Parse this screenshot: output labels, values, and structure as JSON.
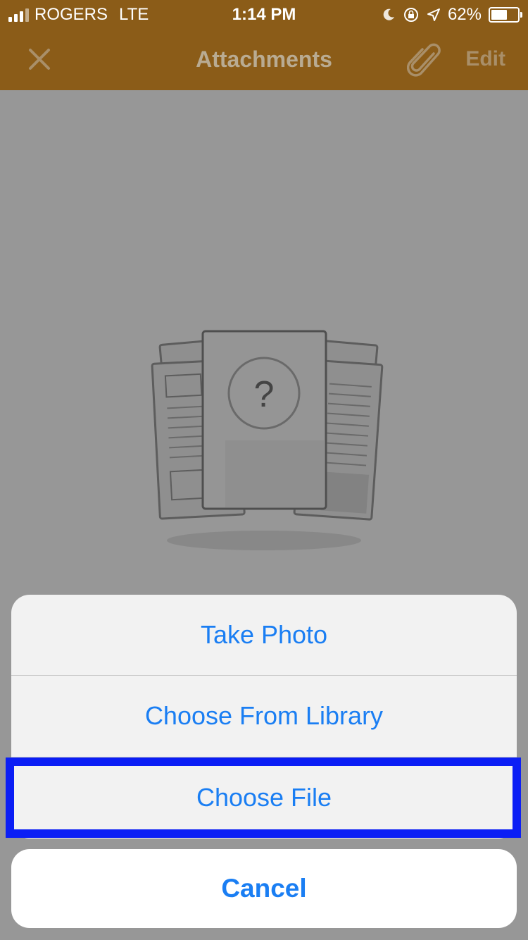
{
  "status_bar": {
    "carrier": "ROGERS",
    "network": "LTE",
    "time": "1:14 PM",
    "battery_text": "62%",
    "battery_level": 0.62,
    "icons": [
      "moon-icon",
      "rotation-lock-icon",
      "location-arrow-icon",
      "battery-icon"
    ]
  },
  "nav": {
    "title": "Attachments",
    "edit_label": "Edit",
    "icons": [
      "close-icon",
      "paperclip-icon"
    ]
  },
  "empty_state": {
    "icon": "question-mark-icon",
    "question_mark": "?"
  },
  "action_sheet": {
    "items": [
      {
        "label": "Take Photo"
      },
      {
        "label": "Choose From Library"
      },
      {
        "label": "Choose File"
      }
    ],
    "cancel_label": "Cancel"
  },
  "colors": {
    "nav_bg": "#8b5c18",
    "overlay_bg": "#979797",
    "action_blue": "#1a7ef3",
    "highlight_border": "#0b1ef5"
  }
}
